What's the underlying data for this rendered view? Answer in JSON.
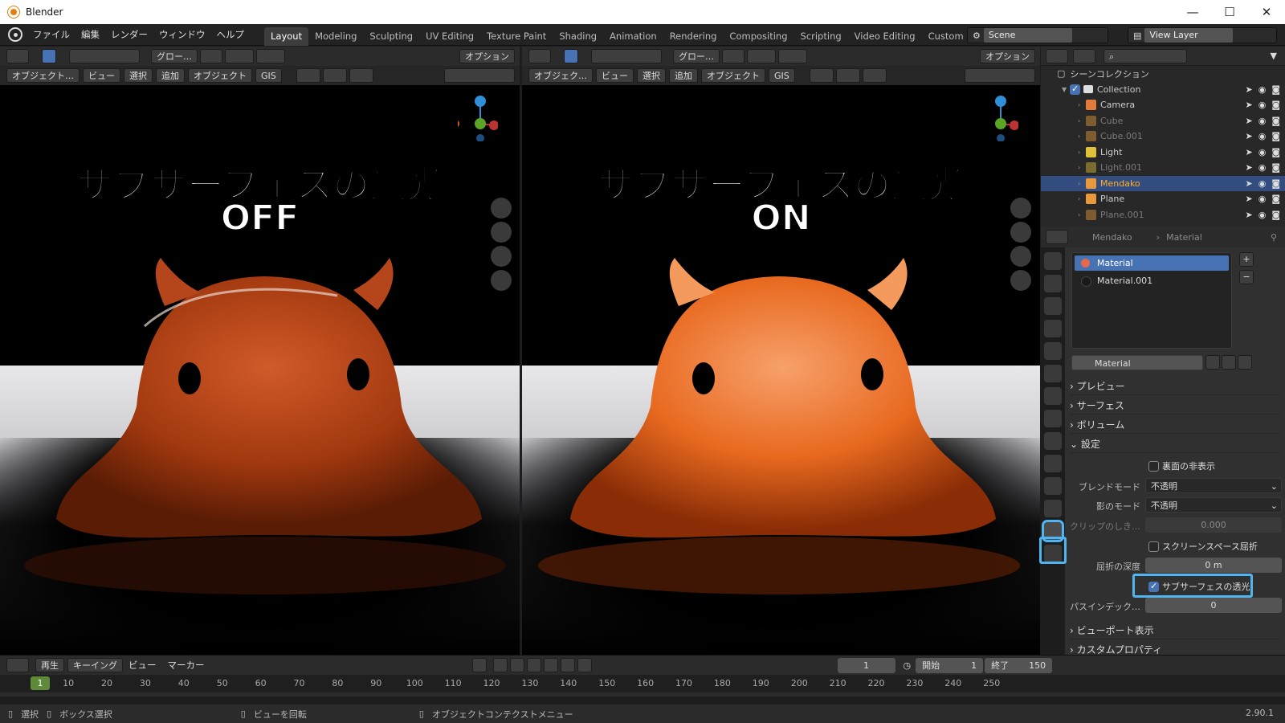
{
  "window": {
    "title": "Blender"
  },
  "menu": [
    "ファイル",
    "編集",
    "レンダー",
    "ウィンドウ",
    "ヘルプ"
  ],
  "workspaces": [
    "Layout",
    "Modeling",
    "Sculpting",
    "UV Editing",
    "Texture Paint",
    "Shading",
    "Animation",
    "Rendering",
    "Compositing",
    "Scripting",
    "Video Editing",
    "Custom"
  ],
  "active_workspace": "Layout",
  "scene": "Scene",
  "view_layer": "View Layer",
  "viewport_header": {
    "transform": "グロー…",
    "options": "オプション",
    "mode_left": "オブジェクト…",
    "mode_right": "オブジェク…",
    "view": "ビュー",
    "select": "選択",
    "add": "追加",
    "object": "オブジェクト",
    "gis": "GIS"
  },
  "viewports": [
    {
      "caption_line1": "サブサーフェスの透光",
      "caption_line2": "OFF",
      "body_color": "#b8431a",
      "highlight": "#d96a35"
    },
    {
      "caption_line1": "サブサーフェスの透光",
      "caption_line2": "ON",
      "body_color": "#e8691f",
      "highlight": "#f7a06b"
    }
  ],
  "outliner": {
    "title": "シーンコレクション",
    "collection": "Collection",
    "items": [
      {
        "name": "Camera",
        "dim": false,
        "selected": false
      },
      {
        "name": "Cube",
        "dim": true,
        "selected": false
      },
      {
        "name": "Cube.001",
        "dim": true,
        "selected": false
      },
      {
        "name": "Light",
        "dim": false,
        "selected": false
      },
      {
        "name": "Light.001",
        "dim": true,
        "selected": false
      },
      {
        "name": "Mendako",
        "dim": false,
        "selected": true
      },
      {
        "name": "Plane",
        "dim": false,
        "selected": false
      },
      {
        "name": "Plane.001",
        "dim": true,
        "selected": false
      }
    ]
  },
  "properties": {
    "breadcrumb_object": "Mendako",
    "breadcrumb_material": "Material",
    "materials": [
      "Material",
      "Material.001"
    ],
    "material_name": "Material",
    "sections": [
      "プレビュー",
      "サーフェス",
      "ボリューム",
      "設定"
    ],
    "backface": "裏面の非表示",
    "blend_mode_label": "ブレンドモード",
    "blend_mode": "不透明",
    "shadow_mode_label": "影のモード",
    "shadow_mode": "不透明",
    "clip_label": "クリップのしき…",
    "clip_value": "0.000",
    "ssr_label": "スクリーンスペース屈折",
    "refraction_depth_label": "屈折の深度",
    "refraction_depth": "0 m",
    "sss_label": "サブサーフェスの透光",
    "pass_index_label": "パスインデック…",
    "pass_index": "0",
    "viewport_display": "ビューポート表示",
    "custom_props": "カスタムプロパティ"
  },
  "timeline": {
    "play": "再生",
    "keying": "キーイング",
    "view": "ビュー",
    "marker": "マーカー",
    "current_frame": "1",
    "start_label": "開始",
    "start": "1",
    "end_label": "終了",
    "end": "150",
    "ticks": [
      "10",
      "20",
      "30",
      "40",
      "50",
      "60",
      "70",
      "80",
      "90",
      "100",
      "110",
      "120",
      "130",
      "140",
      "150",
      "160",
      "170",
      "180",
      "190",
      "200",
      "210",
      "220",
      "230",
      "240",
      "250"
    ]
  },
  "status": {
    "select": "選択",
    "box_select": "ボックス選択",
    "rotate": "ビューを回転",
    "context_menu": "オブジェクトコンテクストメニュー",
    "version": "2.90.1"
  }
}
